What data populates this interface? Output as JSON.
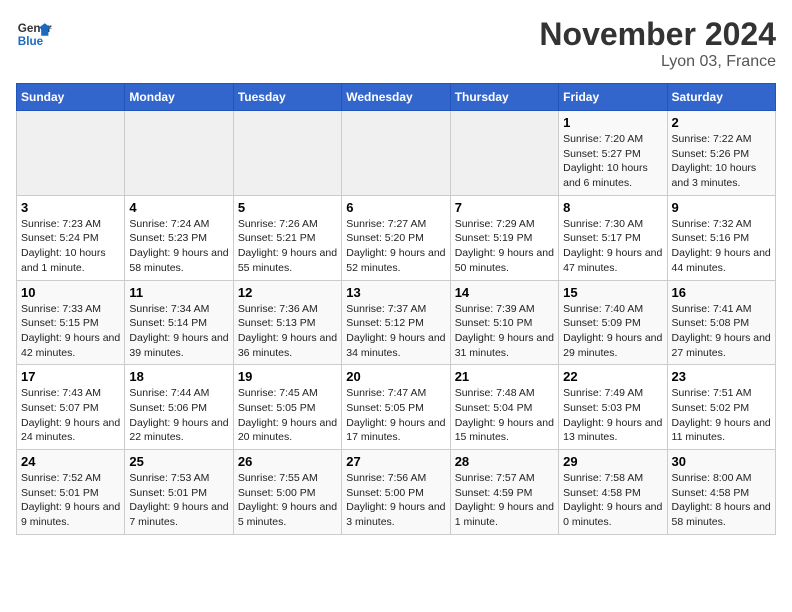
{
  "header": {
    "logo_line1": "General",
    "logo_line2": "Blue",
    "month": "November 2024",
    "location": "Lyon 03, France"
  },
  "weekdays": [
    "Sunday",
    "Monday",
    "Tuesday",
    "Wednesday",
    "Thursday",
    "Friday",
    "Saturday"
  ],
  "weeks": [
    [
      {
        "day": "",
        "empty": true
      },
      {
        "day": "",
        "empty": true
      },
      {
        "day": "",
        "empty": true
      },
      {
        "day": "",
        "empty": true
      },
      {
        "day": "",
        "empty": true
      },
      {
        "day": "1",
        "sunrise": "7:20 AM",
        "sunset": "5:27 PM",
        "daylight": "10 hours and 6 minutes."
      },
      {
        "day": "2",
        "sunrise": "7:22 AM",
        "sunset": "5:26 PM",
        "daylight": "10 hours and 3 minutes."
      }
    ],
    [
      {
        "day": "3",
        "sunrise": "7:23 AM",
        "sunset": "5:24 PM",
        "daylight": "10 hours and 1 minute."
      },
      {
        "day": "4",
        "sunrise": "7:24 AM",
        "sunset": "5:23 PM",
        "daylight": "9 hours and 58 minutes."
      },
      {
        "day": "5",
        "sunrise": "7:26 AM",
        "sunset": "5:21 PM",
        "daylight": "9 hours and 55 minutes."
      },
      {
        "day": "6",
        "sunrise": "7:27 AM",
        "sunset": "5:20 PM",
        "daylight": "9 hours and 52 minutes."
      },
      {
        "day": "7",
        "sunrise": "7:29 AM",
        "sunset": "5:19 PM",
        "daylight": "9 hours and 50 minutes."
      },
      {
        "day": "8",
        "sunrise": "7:30 AM",
        "sunset": "5:17 PM",
        "daylight": "9 hours and 47 minutes."
      },
      {
        "day": "9",
        "sunrise": "7:32 AM",
        "sunset": "5:16 PM",
        "daylight": "9 hours and 44 minutes."
      }
    ],
    [
      {
        "day": "10",
        "sunrise": "7:33 AM",
        "sunset": "5:15 PM",
        "daylight": "9 hours and 42 minutes."
      },
      {
        "day": "11",
        "sunrise": "7:34 AM",
        "sunset": "5:14 PM",
        "daylight": "9 hours and 39 minutes."
      },
      {
        "day": "12",
        "sunrise": "7:36 AM",
        "sunset": "5:13 PM",
        "daylight": "9 hours and 36 minutes."
      },
      {
        "day": "13",
        "sunrise": "7:37 AM",
        "sunset": "5:12 PM",
        "daylight": "9 hours and 34 minutes."
      },
      {
        "day": "14",
        "sunrise": "7:39 AM",
        "sunset": "5:10 PM",
        "daylight": "9 hours and 31 minutes."
      },
      {
        "day": "15",
        "sunrise": "7:40 AM",
        "sunset": "5:09 PM",
        "daylight": "9 hours and 29 minutes."
      },
      {
        "day": "16",
        "sunrise": "7:41 AM",
        "sunset": "5:08 PM",
        "daylight": "9 hours and 27 minutes."
      }
    ],
    [
      {
        "day": "17",
        "sunrise": "7:43 AM",
        "sunset": "5:07 PM",
        "daylight": "9 hours and 24 minutes."
      },
      {
        "day": "18",
        "sunrise": "7:44 AM",
        "sunset": "5:06 PM",
        "daylight": "9 hours and 22 minutes."
      },
      {
        "day": "19",
        "sunrise": "7:45 AM",
        "sunset": "5:05 PM",
        "daylight": "9 hours and 20 minutes."
      },
      {
        "day": "20",
        "sunrise": "7:47 AM",
        "sunset": "5:05 PM",
        "daylight": "9 hours and 17 minutes."
      },
      {
        "day": "21",
        "sunrise": "7:48 AM",
        "sunset": "5:04 PM",
        "daylight": "9 hours and 15 minutes."
      },
      {
        "day": "22",
        "sunrise": "7:49 AM",
        "sunset": "5:03 PM",
        "daylight": "9 hours and 13 minutes."
      },
      {
        "day": "23",
        "sunrise": "7:51 AM",
        "sunset": "5:02 PM",
        "daylight": "9 hours and 11 minutes."
      }
    ],
    [
      {
        "day": "24",
        "sunrise": "7:52 AM",
        "sunset": "5:01 PM",
        "daylight": "9 hours and 9 minutes."
      },
      {
        "day": "25",
        "sunrise": "7:53 AM",
        "sunset": "5:01 PM",
        "daylight": "9 hours and 7 minutes."
      },
      {
        "day": "26",
        "sunrise": "7:55 AM",
        "sunset": "5:00 PM",
        "daylight": "9 hours and 5 minutes."
      },
      {
        "day": "27",
        "sunrise": "7:56 AM",
        "sunset": "5:00 PM",
        "daylight": "9 hours and 3 minutes."
      },
      {
        "day": "28",
        "sunrise": "7:57 AM",
        "sunset": "4:59 PM",
        "daylight": "9 hours and 1 minute."
      },
      {
        "day": "29",
        "sunrise": "7:58 AM",
        "sunset": "4:58 PM",
        "daylight": "9 hours and 0 minutes."
      },
      {
        "day": "30",
        "sunrise": "8:00 AM",
        "sunset": "4:58 PM",
        "daylight": "8 hours and 58 minutes."
      }
    ]
  ],
  "labels": {
    "sunrise": "Sunrise:",
    "sunset": "Sunset:",
    "daylight": "Daylight:"
  }
}
